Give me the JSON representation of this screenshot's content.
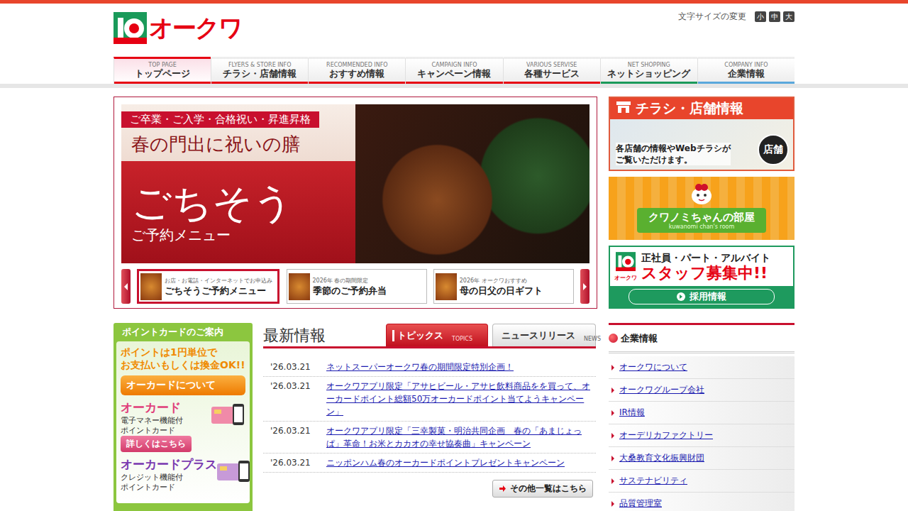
{
  "header": {
    "logo": "オークワ",
    "font_size_label": "文字サイズの変更",
    "font_sizes": [
      "小",
      "中",
      "大"
    ]
  },
  "nav": [
    {
      "en": "TOP PAGE",
      "ja": "トップページ",
      "selected": true,
      "color": "#e60012"
    },
    {
      "en": "FLYERS & STORE INFO",
      "ja": "チラシ・店舗情報",
      "selected": false,
      "color": "#e60012"
    },
    {
      "en": "RECOMMENDED INFO",
      "ja": "おすすめ情報",
      "selected": false,
      "color": "#e60012"
    },
    {
      "en": "CAMPAIGN INFO",
      "ja": "キャンペーン情報",
      "selected": false,
      "color": "#e60012"
    },
    {
      "en": "VARIOUS SERVISE",
      "ja": "各種サービス",
      "selected": false,
      "color": "#e60012"
    },
    {
      "en": "NET SHOPPING",
      "ja": "ネットショッピング",
      "selected": false,
      "color": "#1a9a5a"
    },
    {
      "en": "COMPANY INFO",
      "ja": "企業情報",
      "selected": false,
      "color": "#5aa8dc"
    }
  ],
  "slider": {
    "banner": {
      "tagline": "ご卒業・ご入学・合格祝い・昇進昇格",
      "title": "春の門出に祝いの膳",
      "headline": "ごちそう",
      "sub": "ご予約メニュー"
    },
    "thumbs": [
      {
        "small": "お店・お電話・インターネットでお申込み",
        "label": "ごちそうご予約メニュー",
        "selected": true
      },
      {
        "small": "2026年 春の期間限定",
        "label": "季節のご予約弁当",
        "selected": false
      },
      {
        "small": "2026年 オークワおすすめ",
        "label": "母の日父の日ギフト",
        "selected": false
      }
    ]
  },
  "side_banners": {
    "flyer": {
      "title": "チラシ・店舗情報",
      "line1": "各店舗の情報やWebチラシが",
      "line2": "ご覧いただけます。",
      "badge": "店舗"
    },
    "kuwanomi": {
      "title": "クワノミちゃんの部屋",
      "sub": "kuwanomi chan's room"
    },
    "recruit": {
      "logo": "オークワ",
      "line1": "正社員・パート・アルバイト",
      "line2": "スタッフ募集中!!",
      "button": "採用情報"
    }
  },
  "point_card": {
    "title": "ポイントカードのご案内",
    "point1": "ポイントは1円単位で",
    "point2": "お支払いもしくは換金OK!!",
    "about": "オーカードについて",
    "cards": [
      {
        "name": "オーカード",
        "desc1": "電子マネー機能付",
        "desc2": "ポイントカード",
        "button": "詳しくはこちら"
      },
      {
        "name": "オーカードプラス",
        "desc1": "クレジット機能付",
        "desc2": "ポイントカード"
      }
    ]
  },
  "news": {
    "title": "最新情報",
    "tabs": [
      {
        "label": "トピックス",
        "en": "TOPICS",
        "selected": true
      },
      {
        "label": "ニュースリリース",
        "en": "NEWS",
        "selected": false
      }
    ],
    "items": [
      {
        "date": "'26.03.21",
        "text": "ネットスーパーオークワ春の期間限定特別企画！"
      },
      {
        "date": "'26.03.21",
        "text": "オークワアプリ限定「アサヒビール・アサヒ飲料商品をを買って、オーカードポイント総額50万オーカードポイント当てようキャンペーン」"
      },
      {
        "date": "'26.03.21",
        "text": "オークワアプリ限定「三幸製菓・明治共同企画　春の「あまじょっぱ」革命！お米とカカオの幸せ協奏曲」キャンペーン"
      },
      {
        "date": "'26.03.21",
        "text": "ニッポンハム春のオーカードポイントプレゼントキャンペーン"
      }
    ],
    "more": "その他一覧はこちら"
  },
  "company": {
    "title": "企業情報",
    "links": [
      "オークワについて",
      "オークワグループ会社",
      "IR情報",
      "オーデリカファクトリー",
      "大桑教育文化振興財団",
      "サステナビリティ",
      "品質管理室"
    ]
  }
}
